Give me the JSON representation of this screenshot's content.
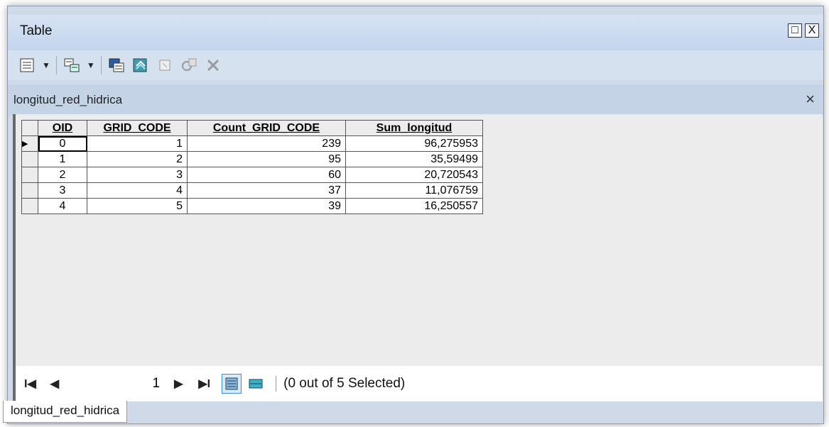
{
  "window": {
    "title": "Table",
    "restore_label": "□",
    "close_label": "X"
  },
  "table_tab": {
    "title": "longitud_red_hidrica",
    "close_label": "×"
  },
  "grid": {
    "columns": [
      "OID",
      "GRID_CODE",
      "Count_GRID_CODE",
      "Sum_longitud"
    ],
    "rows": [
      [
        "0",
        "1",
        "239",
        "96,275953"
      ],
      [
        "1",
        "2",
        "95",
        "35,59499"
      ],
      [
        "2",
        "3",
        "60",
        "20,720543"
      ],
      [
        "3",
        "4",
        "37",
        "11,076759"
      ],
      [
        "4",
        "5",
        "39",
        "16,250557"
      ]
    ],
    "current_row_marker": "▶"
  },
  "status": {
    "first_label": "I◀",
    "prev_label": "◀",
    "record": "1",
    "next_label": "▶",
    "last_label": "▶I",
    "selection_text": "(0 out of 5 Selected)"
  },
  "bottom_tab": {
    "label": "longitud_red_hidrica"
  },
  "icons": [
    "table-options-icon",
    "related-tables-icon",
    "select-by-attributes-icon",
    "switch-selection-icon",
    "clear-selection-icon",
    "zoom-to-selected-icon",
    "delete-selected-icon",
    "show-all-records-icon",
    "show-selected-records-icon"
  ]
}
